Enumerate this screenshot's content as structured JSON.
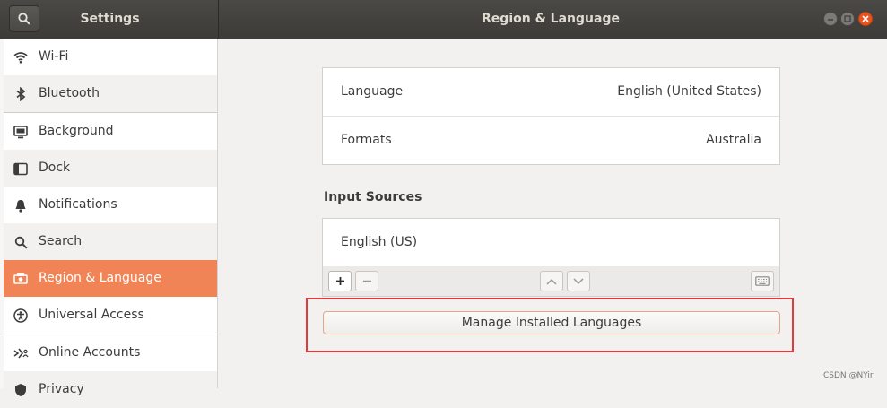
{
  "header": {
    "settings_title": "Settings",
    "panel_title": "Region & Language"
  },
  "sidebar": {
    "items": [
      {
        "label": "Wi-Fi",
        "icon": "wifi-icon"
      },
      {
        "label": "Bluetooth",
        "icon": "bluetooth-icon"
      },
      {
        "label": "Background",
        "icon": "background-icon"
      },
      {
        "label": "Dock",
        "icon": "dock-icon"
      },
      {
        "label": "Notifications",
        "icon": "bell-icon"
      },
      {
        "label": "Search",
        "icon": "search-icon"
      },
      {
        "label": "Region & Language",
        "icon": "region-icon",
        "active": true
      },
      {
        "label": "Universal Access",
        "icon": "accessibility-icon"
      },
      {
        "label": "Online Accounts",
        "icon": "online-accounts-icon"
      },
      {
        "label": "Privacy",
        "icon": "privacy-icon"
      }
    ]
  },
  "region": {
    "language_label": "Language",
    "language_value": "English (United States)",
    "formats_label": "Formats",
    "formats_value": "Australia"
  },
  "input_sources": {
    "title": "Input Sources",
    "items": [
      "English (US)"
    ]
  },
  "buttons": {
    "manage_languages": "Manage Installed Languages"
  },
  "watermark": "CSDN @NYir",
  "colors": {
    "accent": "#f08456",
    "titlebar": "#3c3b37",
    "highlight": "#e0393e",
    "close": "#e95420"
  }
}
